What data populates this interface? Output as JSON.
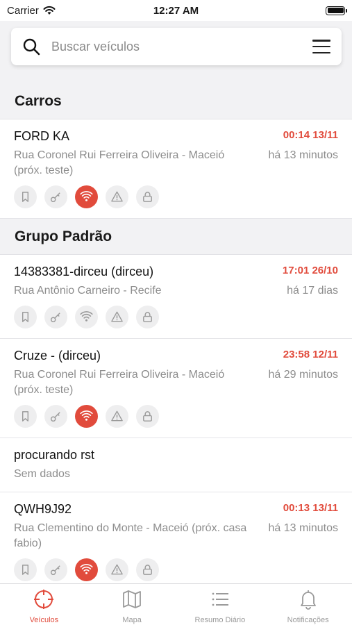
{
  "status_bar": {
    "carrier": "Carrier",
    "time": "12:27 AM"
  },
  "search": {
    "placeholder": "Buscar veículos"
  },
  "sections": [
    {
      "title": "Carros",
      "vehicles": [
        {
          "name": "FORD KA",
          "time": "00:14 13/11",
          "address": "Rua Coronel Rui Ferreira Oliveira - Maceió (próx. teste)",
          "ago": "há 13 minutos",
          "wifi_active": true
        }
      ]
    },
    {
      "title": "Grupo Padrão",
      "vehicles": [
        {
          "name": "14383381-dirceu  (dirceu)",
          "time": "17:01 26/10",
          "address": "Rua Antônio Carneiro - Recife",
          "ago": "há 17 dias",
          "wifi_active": false
        },
        {
          "name": "Cruze -  (dirceu)",
          "time": "23:58 12/11",
          "address": "Rua Coronel Rui Ferreira Oliveira - Maceió (próx. teste)",
          "ago": "há 29 minutos",
          "wifi_active": true
        },
        {
          "name": "procurando rst",
          "time": "",
          "address": "Sem dados",
          "ago": "",
          "wifi_active": false,
          "no_icons": true
        },
        {
          "name": "QWH9J92",
          "time": "00:13 13/11",
          "address": "Rua Clementino do Monte - Maceió (próx. casa fabio)",
          "ago": "há 13 minutos",
          "wifi_active": true
        }
      ]
    }
  ],
  "tabs": [
    {
      "label": "Veículos",
      "icon": "crosshair-icon",
      "active": true
    },
    {
      "label": "Mapa",
      "icon": "map-icon",
      "active": false
    },
    {
      "label": "Resumo Diário",
      "icon": "list-icon",
      "active": false
    },
    {
      "label": "Notificações",
      "icon": "bell-icon",
      "active": false
    }
  ],
  "colors": {
    "accent": "#e14b3c",
    "muted": "#8d8d8d",
    "icon_bg": "#eeeeef"
  }
}
